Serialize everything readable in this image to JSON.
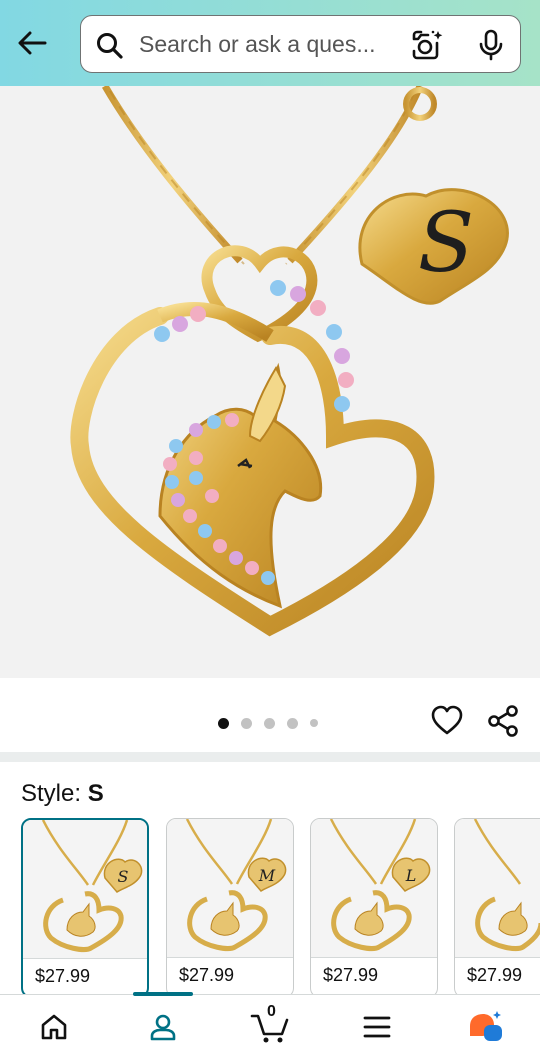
{
  "search": {
    "placeholder": "Search or ask a ques..."
  },
  "icons": {
    "back": "back-arrow-icon",
    "search": "search-icon",
    "lens": "camera-lens-icon",
    "mic": "microphone-icon",
    "wishlist": "heart-icon",
    "share": "share-icon"
  },
  "gallery": {
    "dot_count": 5,
    "active_index": 0
  },
  "style": {
    "label": "Style:",
    "selected": "S"
  },
  "swatches": [
    {
      "letter": "S",
      "price": "$27.99",
      "selected": true
    },
    {
      "letter": "M",
      "price": "$27.99",
      "selected": false
    },
    {
      "letter": "L",
      "price": "$27.99",
      "selected": false
    },
    {
      "letter": "",
      "price": "$27.99",
      "selected": false
    }
  ],
  "nav": {
    "items": [
      "home-icon",
      "account-icon",
      "cart-icon",
      "menu-icon",
      "ai-assistant-icon"
    ],
    "active": "account-icon",
    "cart_count": "0"
  },
  "colors": {
    "accent": "#007185",
    "gold": "#d7ad4a",
    "header_start": "#82d8e3",
    "header_end": "#a6e3c8"
  }
}
